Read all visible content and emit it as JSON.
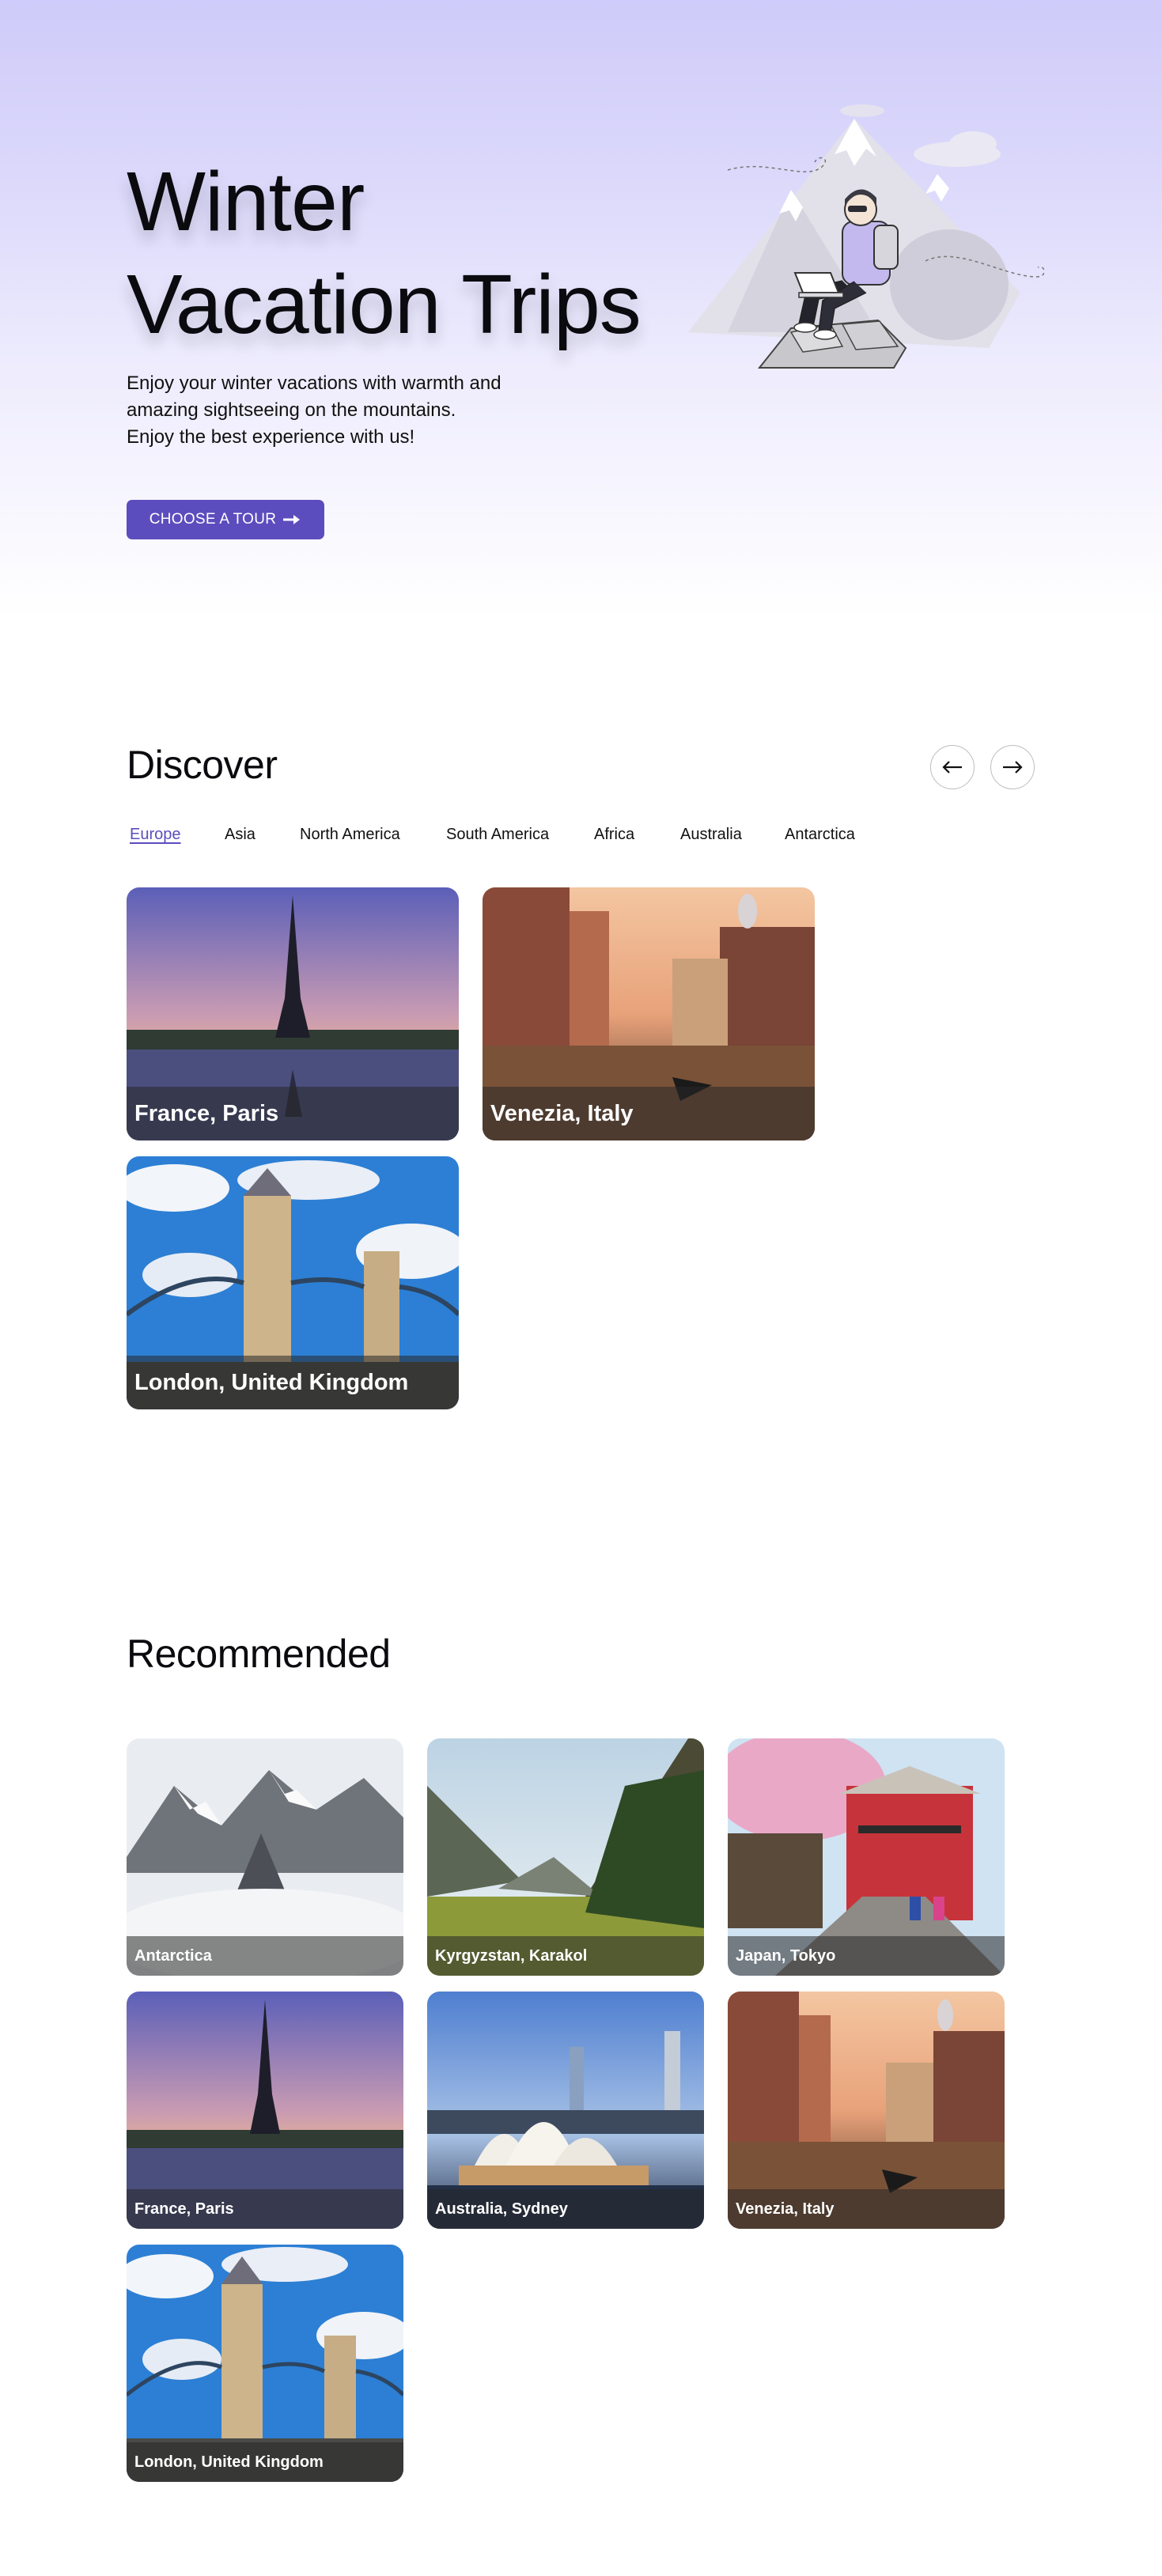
{
  "hero": {
    "title_line1": "Winter",
    "title_line2": "Vacation Trips",
    "desc_line1": "Enjoy your winter vacations with warmth and",
    "desc_line2": "amazing sightseeing on the mountains.",
    "desc_line3": "Enjoy the best experience with us!",
    "cta_label": "CHOOSE A TOUR",
    "cta_icon": "arrow-right-icon"
  },
  "discover": {
    "title": "Discover",
    "prev_icon": "arrow-left-icon",
    "next_icon": "arrow-right-icon",
    "tabs": [
      "Europe",
      "Asia",
      "North America",
      "South America",
      "Africa",
      "Australia",
      "Antarctica"
    ],
    "active_tab": "Europe",
    "cards": [
      {
        "label": "France, Paris"
      },
      {
        "label": "Venezia, Italy"
      },
      {
        "label": "London, United Kingdom"
      }
    ]
  },
  "recommended": {
    "title": "Recommended",
    "cards": [
      {
        "label": "Antarctica"
      },
      {
        "label": "Kyrgyzstan, Karakol"
      },
      {
        "label": "Japan, Tokyo"
      },
      {
        "label": "France, Paris"
      },
      {
        "label": "Australia, Sydney"
      },
      {
        "label": "Venezia, Italy"
      },
      {
        "label": "London, United Kingdom"
      }
    ]
  },
  "colors": {
    "accent": "#5b4dbd",
    "hero_gradient_top": "#cfcbfa"
  }
}
